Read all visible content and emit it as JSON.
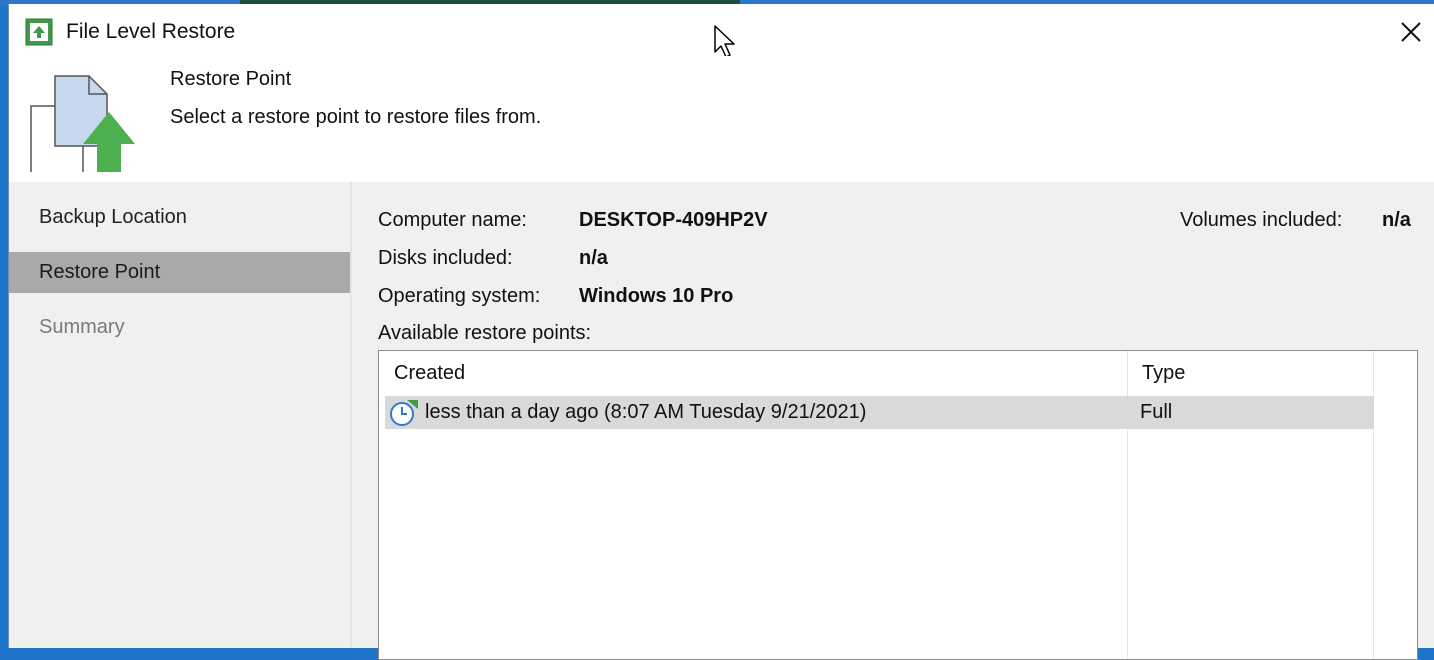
{
  "window": {
    "title": "File Level Restore"
  },
  "header": {
    "title": "Restore Point",
    "subtitle": "Select a restore point to restore files from."
  },
  "sidebar": {
    "items": [
      {
        "label": "Backup Location",
        "state": "normal"
      },
      {
        "label": "Restore Point",
        "state": "active"
      },
      {
        "label": "Summary",
        "state": "disabled"
      }
    ]
  },
  "details": {
    "computer_name_label": "Computer name:",
    "computer_name": "DESKTOP-409HP2V",
    "volumes_label": "Volumes included:",
    "volumes": "n/a",
    "disks_label": "Disks included:",
    "disks": "n/a",
    "os_label": "Operating system:",
    "os": "Windows 10 Pro",
    "available_label": "Available restore points:"
  },
  "restore_points": {
    "columns": [
      "Created",
      "Type"
    ],
    "rows": [
      {
        "created": "less than a day ago (8:07 AM Tuesday 9/21/2021)",
        "type": "Full",
        "icon": "restore-point-clock-icon",
        "selected": true
      }
    ]
  },
  "colors": {
    "accent_green": "#4caf50",
    "selected_nav": "#a9a9a9",
    "panel_bg": "#f0f0f0"
  }
}
